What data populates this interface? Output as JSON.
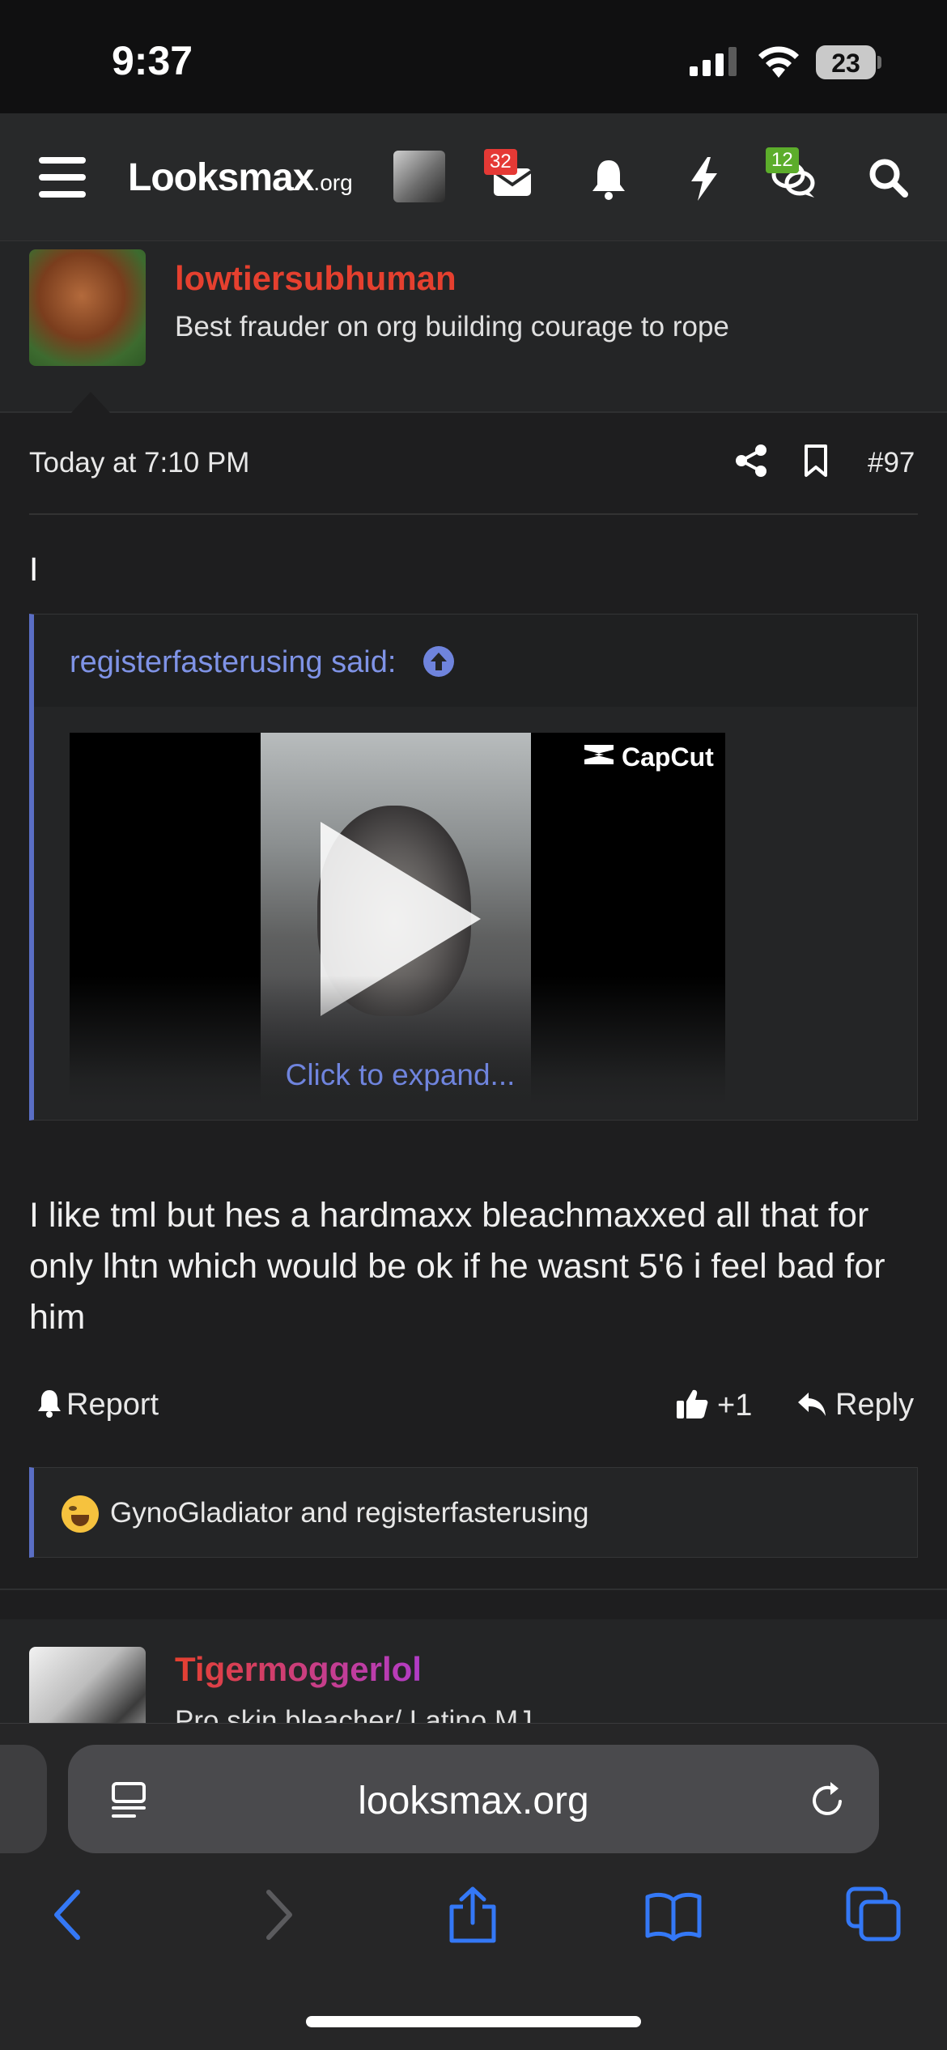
{
  "status_bar": {
    "time": "9:37",
    "battery": "23"
  },
  "nav": {
    "logo_main": "Looksmax",
    "logo_suffix": ".org",
    "inbox_badge": "32",
    "conversations_badge": "12"
  },
  "post": {
    "author": {
      "name": "lowtiersubhuman",
      "title": "Best frauder on org building courage to rope"
    },
    "date": "Today at 7:10 PM",
    "number": "#97",
    "first_line": "I",
    "quote": {
      "author_said": "registerfasterusing said:",
      "video_brand": "CapCut",
      "expand_label": "Click to expand..."
    },
    "body": "I like tml but hes a hardmaxx bleachmaxxed all that for only lhtn which would be ok if he wasnt 5'6 i feel bad for him",
    "actions": {
      "report": "Report",
      "like_count": "+1",
      "reply": "Reply"
    },
    "reactions": "GynoGladiator and registerfasterusing"
  },
  "next_post": {
    "author_name": "Tigermoggerlol",
    "author_title": "Pro skin bleacher/ Latino MJ"
  },
  "safari": {
    "url": "looksmax.org"
  },
  "colors": {
    "accent_blue": "#5a6ec4",
    "username_red": "#e5402f",
    "ios_blue": "#3478f6"
  }
}
